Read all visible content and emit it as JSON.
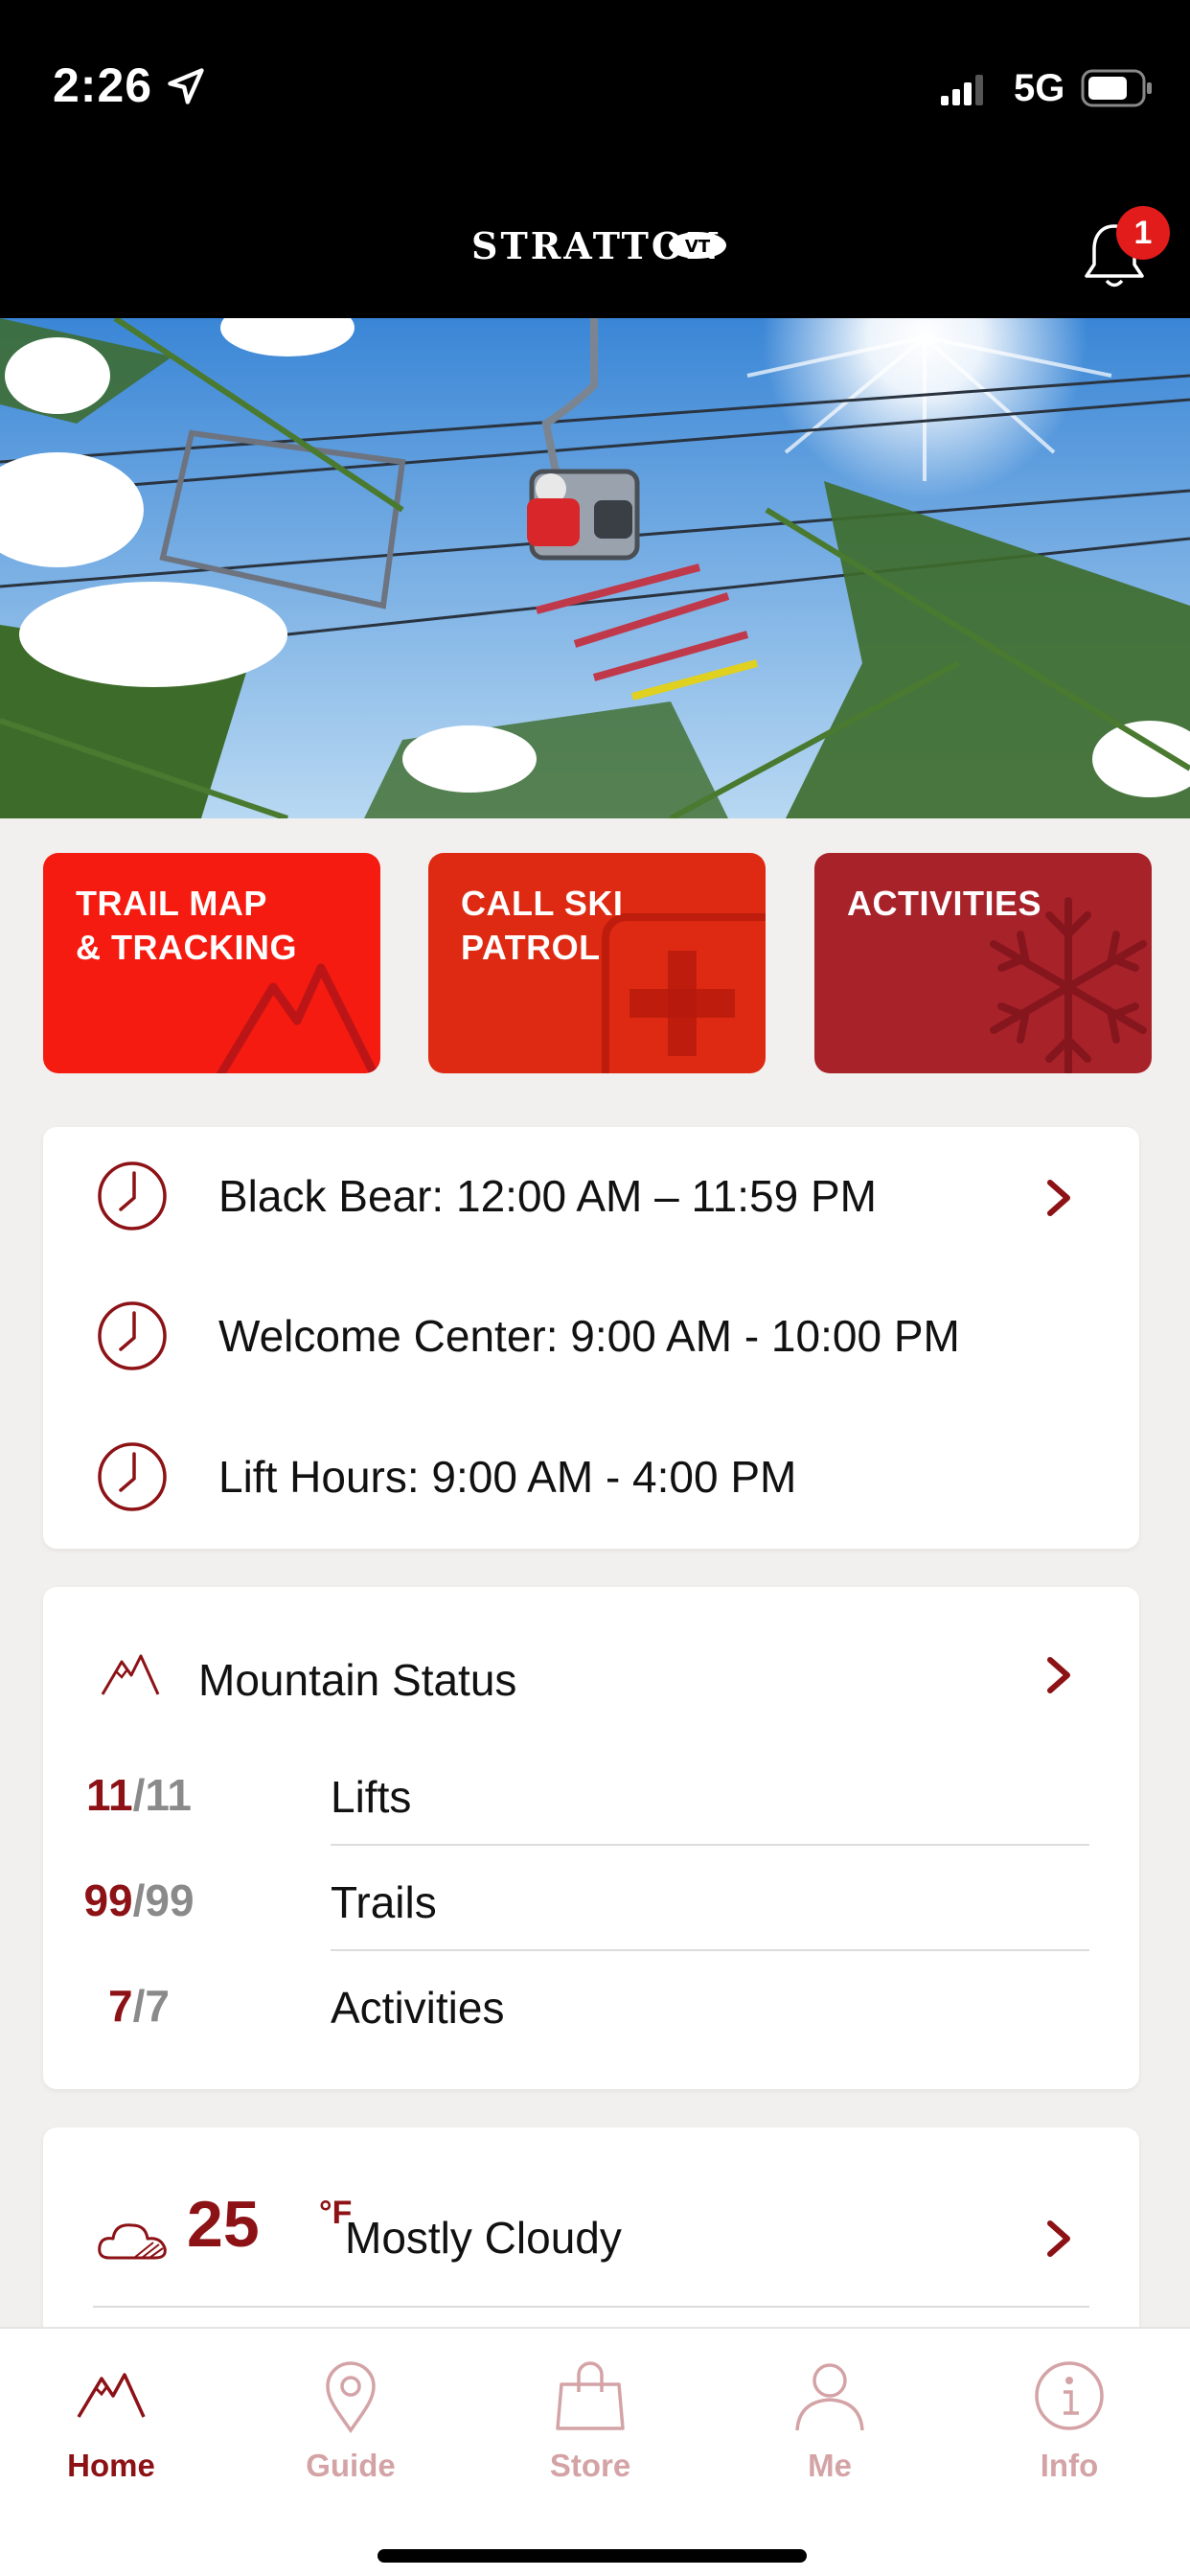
{
  "status_bar": {
    "time": "2:26",
    "network": "5G"
  },
  "header": {
    "logo_text": "STRATTON",
    "logo_badge": "VT",
    "notification_count": "1"
  },
  "tiles": [
    {
      "label": "TRAIL MAP\n& TRACKING",
      "icon": "mountain-icon"
    },
    {
      "label": "CALL SKI\nPATROL",
      "icon": "medical-cross-icon"
    },
    {
      "label": "ACTIVITIES",
      "icon": "snowflake-icon"
    }
  ],
  "hours": [
    {
      "text": "Black Bear: 12:00 AM – 11:59 PM",
      "has_chevron": true
    },
    {
      "text": "Welcome Center:  9:00 AM - 10:00 PM",
      "has_chevron": false
    },
    {
      "text": "Lift Hours: 9:00 AM - 4:00 PM",
      "has_chevron": false
    }
  ],
  "mountain_status": {
    "title": "Mountain Status",
    "rows": [
      {
        "open": "11",
        "total": "/11",
        "label": "Lifts"
      },
      {
        "open": "99",
        "total": "/99",
        "label": "Trails"
      },
      {
        "open": "7",
        "total": "/7",
        "label": "Activities"
      }
    ]
  },
  "weather": {
    "temp": "25",
    "unit": "°F",
    "condition": "Mostly Cloudy"
  },
  "tabs": [
    {
      "label": "Home",
      "icon": "mountain-icon",
      "active": true
    },
    {
      "label": "Guide",
      "icon": "map-pin-icon",
      "active": false
    },
    {
      "label": "Store",
      "icon": "shopping-bag-icon",
      "active": false
    },
    {
      "label": "Me",
      "icon": "person-icon",
      "active": false
    },
    {
      "label": "Info",
      "icon": "info-icon",
      "active": false
    }
  ],
  "colors": {
    "brand_red": "#8c1216",
    "tile_red_1": "#f51b10",
    "tile_red_2": "#de2a13",
    "tile_red_3": "#a8222a"
  }
}
